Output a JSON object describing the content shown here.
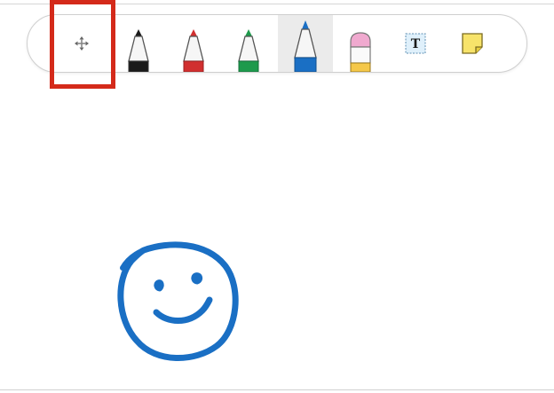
{
  "toolbar": {
    "tools": [
      {
        "name": "move",
        "icon": "move-icon",
        "selected": false
      },
      {
        "name": "pen-black",
        "icon": "pen-icon",
        "color": "#1a1a1a",
        "selected": false
      },
      {
        "name": "pen-red",
        "icon": "pen-icon",
        "color": "#d12f2f",
        "selected": false
      },
      {
        "name": "pen-green",
        "icon": "pen-icon",
        "color": "#1e9a4c",
        "selected": false
      },
      {
        "name": "pen-blue",
        "icon": "pen-icon",
        "color": "#1a6fc4",
        "selected": true
      },
      {
        "name": "eraser",
        "icon": "eraser-icon",
        "colors": [
          "#f0a9cf",
          "#f5c84a"
        ],
        "selected": false
      },
      {
        "name": "text-box",
        "icon": "text-box-icon",
        "label": "T",
        "selected": false
      },
      {
        "name": "sticky-note",
        "icon": "sticky-note-icon",
        "color": "#f7e36a",
        "selected": false
      }
    ]
  },
  "canvas": {
    "drawing": {
      "icon": "smiley-face-doodle",
      "color": "#1a6fc4"
    }
  },
  "highlight": {
    "color": "#d42a1a",
    "target": "move"
  }
}
